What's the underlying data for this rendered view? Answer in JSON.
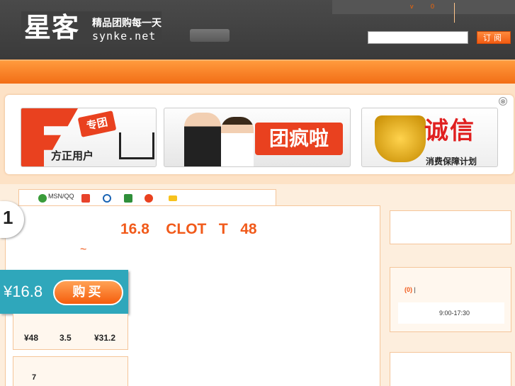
{
  "header": {
    "logo_main": "星客",
    "logo_slogan": "精品团购每一天",
    "logo_domain": "synke.net",
    "topbar_items": [
      "v",
      "0"
    ],
    "subscribe_label": "订阅"
  },
  "banner": {
    "close_label": "⊗",
    "ads": [
      {
        "tag": "专团",
        "text": "方正用户"
      },
      {
        "title": "团疯啦"
      },
      {
        "big": "诚信",
        "sub": "消费保障计划"
      }
    ]
  },
  "share": {
    "msn_label": "MSN/QQ"
  },
  "deal": {
    "rank": "1",
    "title": "16.8    CLOT   T   48",
    "tilde": "~",
    "price": "¥16.8",
    "buy_label": "购买",
    "original_price": "¥48",
    "discount": "3.5",
    "saved": "¥31.2",
    "bought_count": "7"
  },
  "sidebar": {
    "service_count": "(0)",
    "service_sep": " |",
    "hours": "9:00-17:30"
  },
  "colors": {
    "accent": "#f15a1a",
    "nav": "#f26e16",
    "buy_panel": "#2fa7bb"
  }
}
